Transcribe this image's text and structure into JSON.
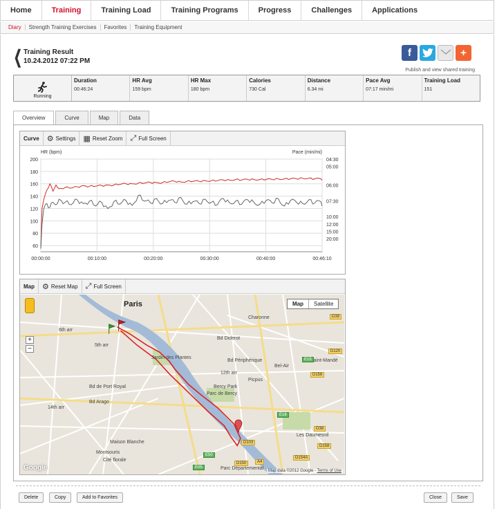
{
  "nav": {
    "items": [
      "Home",
      "Training",
      "Training Load",
      "Training Programs",
      "Progress",
      "Challenges",
      "Applications"
    ],
    "active": "Training"
  },
  "subnav": {
    "items": [
      "Diary",
      "Strength Training Exercises",
      "Favorites",
      "Training Equipment"
    ]
  },
  "result": {
    "title": "Training Result",
    "date": "10.24.2012 07:22 PM"
  },
  "publish_text": "Publish and view shared training",
  "summary": {
    "sport": "Running",
    "cells": [
      {
        "label": "Duration",
        "value": "00:46:24"
      },
      {
        "label": "HR Avg",
        "value": "159  bpm"
      },
      {
        "label": "HR Max",
        "value": "180  bpm"
      },
      {
        "label": "Calories",
        "value": "730  Cal"
      },
      {
        "label": "Distance",
        "value": "6.34  mi"
      },
      {
        "label": "Pace Avg",
        "value": "07:17  min/mi"
      },
      {
        "label": "Training Load",
        "value": "151"
      }
    ]
  },
  "tabs": [
    "Overview",
    "Curve",
    "Map",
    "Data"
  ],
  "curve_widget": {
    "title": "Curve",
    "settings": "Settings",
    "reset_zoom": "Reset Zoom",
    "full_screen": "Full Screen"
  },
  "map_widget": {
    "title": "Map",
    "reset_map": "Reset Map",
    "full_screen": "Full Screen",
    "type_map": "Map",
    "type_satellite": "Satellite",
    "zoom_in": "+",
    "zoom_out": "−",
    "footer_data": "Map data ©2012 Google",
    "footer_terms": "Terms of Use",
    "logo": "Google",
    "labels": [
      "Paris",
      "Charonne",
      "6th arr",
      "5th arr",
      "Jardin des Plantes",
      "Bd Diderot",
      "12th arr",
      "Bel-Air",
      "Picpus",
      "Saint-Mandé",
      "Bercy Park",
      "Parc de Bercy",
      "14th arr",
      "Maison Blanche",
      "Montsouris",
      "Cité florale",
      "Parc Départemental",
      "Les Daumesnil",
      "Bd Arago",
      "Bd de Port Royal",
      "Bd Périphérique"
    ],
    "road_badges": [
      "D39",
      "D120",
      "D156",
      "E15",
      "E18",
      "D38",
      "D158",
      "D103",
      "D154A",
      "A4",
      "D150",
      "E05",
      "E50"
    ]
  },
  "chart_data": {
    "type": "line",
    "xlabel": "",
    "x_ticks": [
      "00:00:00",
      "00:10:00",
      "00:20:00",
      "00:30:00",
      "00:40:00",
      "00:46:10"
    ],
    "y_left_label": "HR (bpm)",
    "y_left_ticks": [
      200,
      180,
      160,
      140,
      120,
      100,
      80,
      60
    ],
    "y_left_lim": [
      50,
      200
    ],
    "y_right_label": "Pace (min/mi)",
    "y_right_ticks": [
      "04:30",
      "05:00",
      "06:00",
      "07:30",
      "10:00",
      "12:00",
      "15:00",
      "20:00"
    ],
    "grid": true,
    "colors": {
      "hr": "#cc2b2b",
      "pace": "#666666"
    },
    "series": [
      {
        "key": "hr",
        "x": [
          0,
          0.2,
          0.5,
          1,
          1.5,
          2,
          2.5,
          3,
          4,
          5,
          6,
          7,
          8,
          9,
          10,
          11,
          12,
          13,
          14,
          15,
          16,
          17,
          18,
          19,
          20,
          21,
          22,
          23,
          24,
          25,
          26,
          27,
          28,
          29,
          30,
          31,
          32,
          33,
          34,
          35,
          36,
          37,
          38,
          39,
          40,
          41,
          42,
          43,
          44,
          45,
          46,
          46.2
        ],
        "values": [
          55,
          120,
          135,
          150,
          160,
          148,
          158,
          152,
          154,
          153,
          155,
          157,
          156,
          156,
          157,
          158,
          158,
          159,
          160,
          160,
          161,
          161,
          162,
          162,
          162,
          163,
          164,
          163,
          164,
          164,
          164,
          165,
          165,
          165,
          166,
          166,
          167,
          166,
          167,
          167,
          167,
          167,
          167,
          168,
          168,
          168,
          168,
          169,
          169,
          168,
          168,
          166
        ]
      },
      {
        "key": "pace",
        "x": [
          0,
          0.2,
          0.5,
          1,
          1.5,
          2,
          2.5,
          3,
          4,
          5,
          6,
          7,
          8,
          9,
          10,
          11,
          12,
          13,
          14,
          15,
          16,
          17,
          18,
          19,
          20,
          21,
          22,
          23,
          24,
          25,
          26,
          27,
          28,
          29,
          30,
          31,
          32,
          33,
          34,
          35,
          36,
          37,
          38,
          39,
          40,
          41,
          42,
          43,
          44,
          45,
          46,
          46.2
        ],
        "values": [
          55,
          95,
          120,
          128,
          122,
          130,
          126,
          135,
          130,
          126,
          134,
          128,
          132,
          124,
          130,
          120,
          131,
          127,
          133,
          125,
          141,
          132,
          129,
          136,
          128,
          133,
          130,
          138,
          127,
          131,
          128,
          135,
          130,
          126,
          136,
          129,
          132,
          127,
          134,
          130,
          127,
          133,
          129,
          136,
          124,
          133,
          130,
          128,
          134,
          129,
          131,
          124
        ]
      }
    ]
  },
  "route": {
    "color": "#dd2222",
    "points": [
      [
        0.3,
        0.18
      ],
      [
        0.34,
        0.22
      ],
      [
        0.39,
        0.28
      ],
      [
        0.43,
        0.32
      ],
      [
        0.46,
        0.37
      ],
      [
        0.48,
        0.42
      ],
      [
        0.52,
        0.5
      ],
      [
        0.56,
        0.56
      ],
      [
        0.61,
        0.63
      ],
      [
        0.66,
        0.72
      ],
      [
        0.68,
        0.8
      ],
      [
        0.67,
        0.84
      ],
      [
        0.65,
        0.79
      ],
      [
        0.63,
        0.73
      ],
      [
        0.58,
        0.65
      ],
      [
        0.54,
        0.58
      ],
      [
        0.5,
        0.51
      ],
      [
        0.46,
        0.44
      ],
      [
        0.42,
        0.36
      ],
      [
        0.36,
        0.28
      ],
      [
        0.31,
        0.2
      ]
    ]
  },
  "buttons": {
    "delete": "Delete",
    "copy": "Copy",
    "add_fav": "Add to Favorites",
    "close": "Close",
    "save": "Save"
  }
}
